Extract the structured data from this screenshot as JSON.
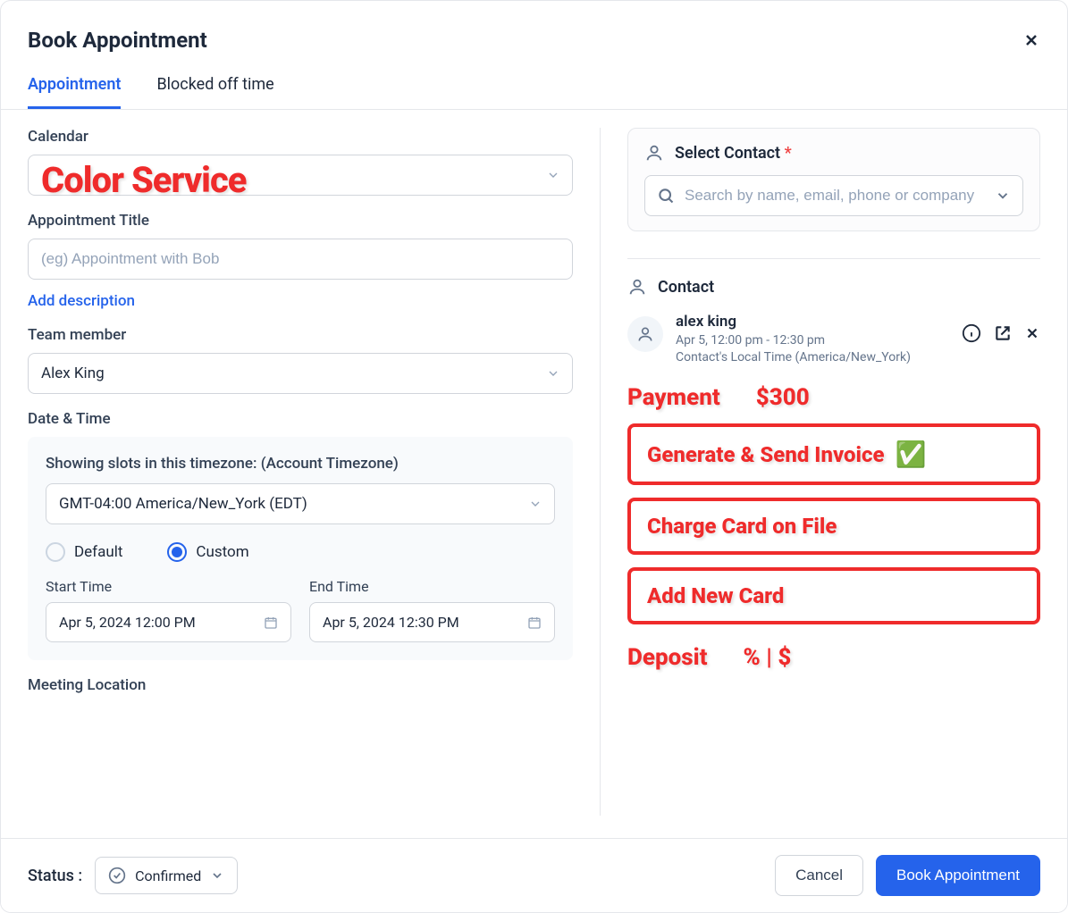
{
  "modal": {
    "title": "Book Appointment"
  },
  "tabs": [
    {
      "label": "Appointment",
      "active": true
    },
    {
      "label": "Blocked off time",
      "active": false
    }
  ],
  "left": {
    "calendar_label": "Calendar",
    "calendar_overlay": "Color Service",
    "title_label": "Appointment Title",
    "title_placeholder": "(eg) Appointment with Bob",
    "add_description": "Add description",
    "team_label": "Team member",
    "team_value": "Alex King",
    "datetime_label": "Date & Time",
    "tz_label": "Showing slots in this timezone: (Account Timezone)",
    "tz_value": "GMT-04:00 America/New_York (EDT)",
    "radio_default": "Default",
    "radio_custom": "Custom",
    "radio_selected": "custom",
    "start_label": "Start Time",
    "start_value": "Apr 5, 2024 12:00 PM",
    "end_label": "End Time",
    "end_value": "Apr 5, 2024 12:30 PM",
    "meeting_location_label": "Meeting Location"
  },
  "right": {
    "select_contact_label": "Select Contact",
    "search_placeholder": "Search by name, email, phone or company",
    "contact_section_label": "Contact",
    "contact": {
      "name": "alex king",
      "time": "Apr 5, 12:00 pm - 12:30 pm",
      "tz_note": "Contact's Local Time (America/New_York)"
    },
    "annotations": {
      "payment_label": "Payment",
      "payment_amount": "$300",
      "btn1": "Generate & Send Invoice",
      "btn2": "Charge Card on File",
      "btn3": "Add New Card",
      "deposit_label": "Deposit",
      "deposit_toggle": "% | $"
    }
  },
  "footer": {
    "status_label": "Status :",
    "status_value": "Confirmed",
    "cancel": "Cancel",
    "submit": "Book Appointment"
  }
}
